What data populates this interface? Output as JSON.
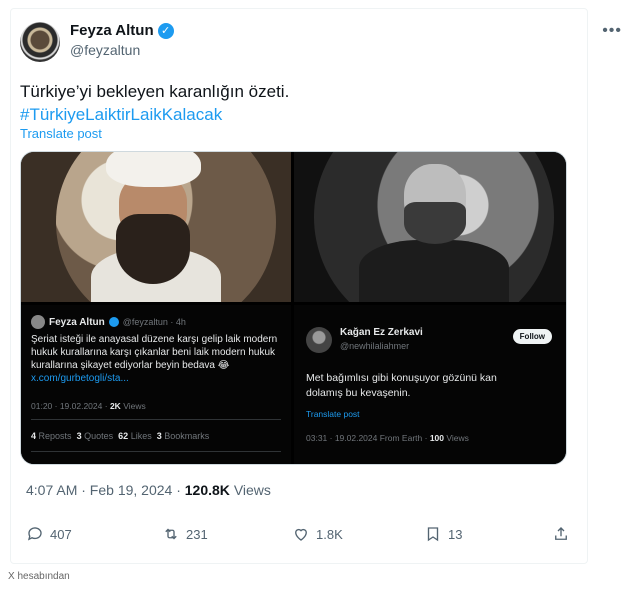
{
  "author": {
    "name": "Feyza Altun",
    "handle": "@feyzaltun"
  },
  "menu_icon": "more-dots-icon",
  "tweet": {
    "text": "Türkiye’yi bekleyen karanlığın özeti.",
    "hashtag": "#TürkiyeLaiktirLaikKalacak",
    "translate": "Translate post"
  },
  "quote_left": {
    "name": "Feyza Altun",
    "meta": "@feyzaltun · 4h",
    "body": "Şeriat isteği ile anayasal düzene karşı gelip laik modern hukuk kurallarına karşı çıkanlar beni laik modern hukuk kurallarına şikayet ediyorlar beyin bedava 😂",
    "link": "x.com/gurbetogli/sta...",
    "time": "01:20 · 19.02.2024 ·",
    "views": "2K",
    "views_label": "Views",
    "stats": {
      "reposts": "4",
      "reposts_label": "Reposts",
      "quotes": "3",
      "quotes_label": "Quotes",
      "likes": "62",
      "likes_label": "Likes",
      "bookmarks": "3",
      "bookmarks_label": "Bookmarks"
    }
  },
  "quote_right": {
    "name": "Kağan Ez Zerkavi",
    "handle": "@newhilaliahmer",
    "follow": "Follow",
    "body": "Met bağımlısı gibi konuşuyor gözünü kan dolamış bu kevaşenin.",
    "translate": "Translate post",
    "time": "03:31 · 19.02.2024 From Earth ·",
    "views": "100",
    "views_label": "Views"
  },
  "timestamp": {
    "time": "4:07 AM · Feb 19, 2024 ·",
    "views": "120.8K",
    "views_label": "Views"
  },
  "actions": {
    "replies": "407",
    "reposts": "231",
    "likes": "1.8K",
    "bookmarks": "13"
  },
  "footer": "X hesabından",
  "colors": {
    "accent": "#1d9bf0",
    "text": "#0f1419",
    "muted": "#536471"
  }
}
